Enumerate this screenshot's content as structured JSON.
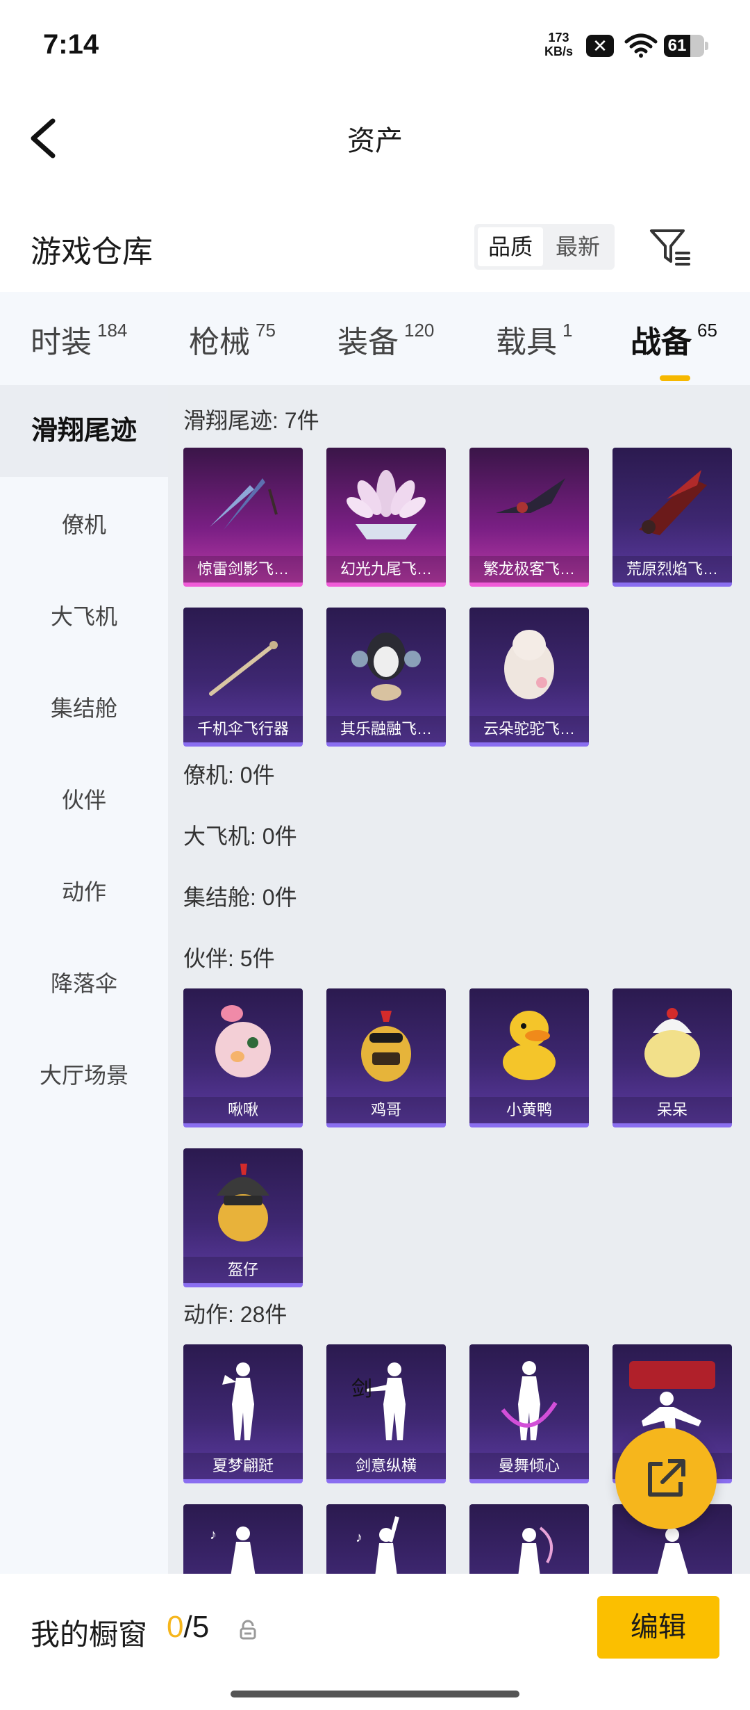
{
  "status_bar": {
    "time": "7:14",
    "net_speed": "173",
    "net_unit": "KB/s",
    "battery": "61"
  },
  "header": {
    "title": "资产"
  },
  "warehouse": {
    "label": "游戏仓库",
    "sort_options": [
      "品质",
      "最新"
    ],
    "selected_sort": "品质"
  },
  "tabs": [
    {
      "label": "时装",
      "count": "184"
    },
    {
      "label": "枪械",
      "count": "75"
    },
    {
      "label": "装备",
      "count": "120"
    },
    {
      "label": "载具",
      "count": "1"
    },
    {
      "label": "战备",
      "count": "65"
    }
  ],
  "active_tab": "战备",
  "sidebar": {
    "items": [
      "滑翔尾迹",
      "僚机",
      "大飞机",
      "集结舱",
      "伙伴",
      "动作",
      "降落伞",
      "大厅场景"
    ],
    "selected": "滑翔尾迹"
  },
  "sections": {
    "glide": {
      "title": "滑翔尾迹: 7件",
      "items": [
        "惊雷剑影飞…",
        "幻光九尾飞…",
        "繁龙极客飞…",
        "荒原烈焰飞…",
        "千机伞飞行器",
        "其乐融融飞…",
        "云朵驼驼飞…"
      ]
    },
    "wingman": {
      "title": "僚机: 0件"
    },
    "plane": {
      "title": "大飞机: 0件"
    },
    "capsule": {
      "title": "集结舱: 0件"
    },
    "companion": {
      "title": "伙伴: 5件",
      "items": [
        "啾啾",
        "鸡哥",
        "小黄鸭",
        "呆呆",
        "盔仔"
      ]
    },
    "emote": {
      "title": "动作: 28件",
      "items": [
        "夏梦翩跹",
        "剑意纵横",
        "曼舞倾心",
        "",
        "",
        "",
        "",
        ""
      ]
    }
  },
  "showcase": {
    "label": "我的橱窗",
    "current": "0",
    "total": "/5",
    "edit_label": "编辑"
  },
  "colors": {
    "accent": "#f6b61c",
    "edit_button": "#fbbf00",
    "card_purple": "#3e2771",
    "card_pink": "#7a1f84"
  }
}
